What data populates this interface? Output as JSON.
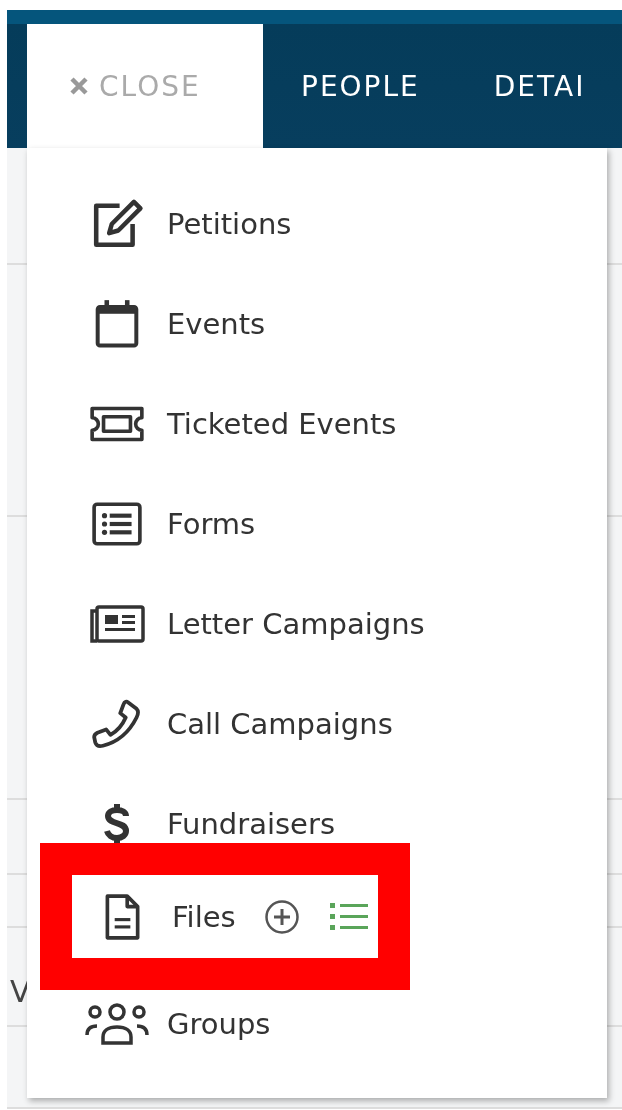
{
  "header_tabs": [
    {
      "label": "CLOSE",
      "kind": "close",
      "selected": true
    },
    {
      "label": "PEOPLE",
      "kind": "tab",
      "selected": false
    },
    {
      "label": "DETAI",
      "kind": "tab",
      "selected": false
    }
  ],
  "background_text": "V",
  "menu_items": [
    {
      "label": "Petitions",
      "kind": "petition"
    },
    {
      "label": "Events",
      "kind": "calendar"
    },
    {
      "label": "Ticketed Events",
      "kind": "ticket"
    },
    {
      "label": "Forms",
      "kind": "form"
    },
    {
      "label": "Letter Campaigns",
      "kind": "letter"
    },
    {
      "label": "Call Campaigns",
      "kind": "phone"
    },
    {
      "label": "Fundraisers",
      "kind": "dollar"
    },
    {
      "label": "Files",
      "kind": "file",
      "highlighted": true,
      "actions": [
        {
          "kind": "add"
        },
        {
          "kind": "list"
        }
      ]
    },
    {
      "label": "Groups",
      "kind": "groups"
    }
  ]
}
